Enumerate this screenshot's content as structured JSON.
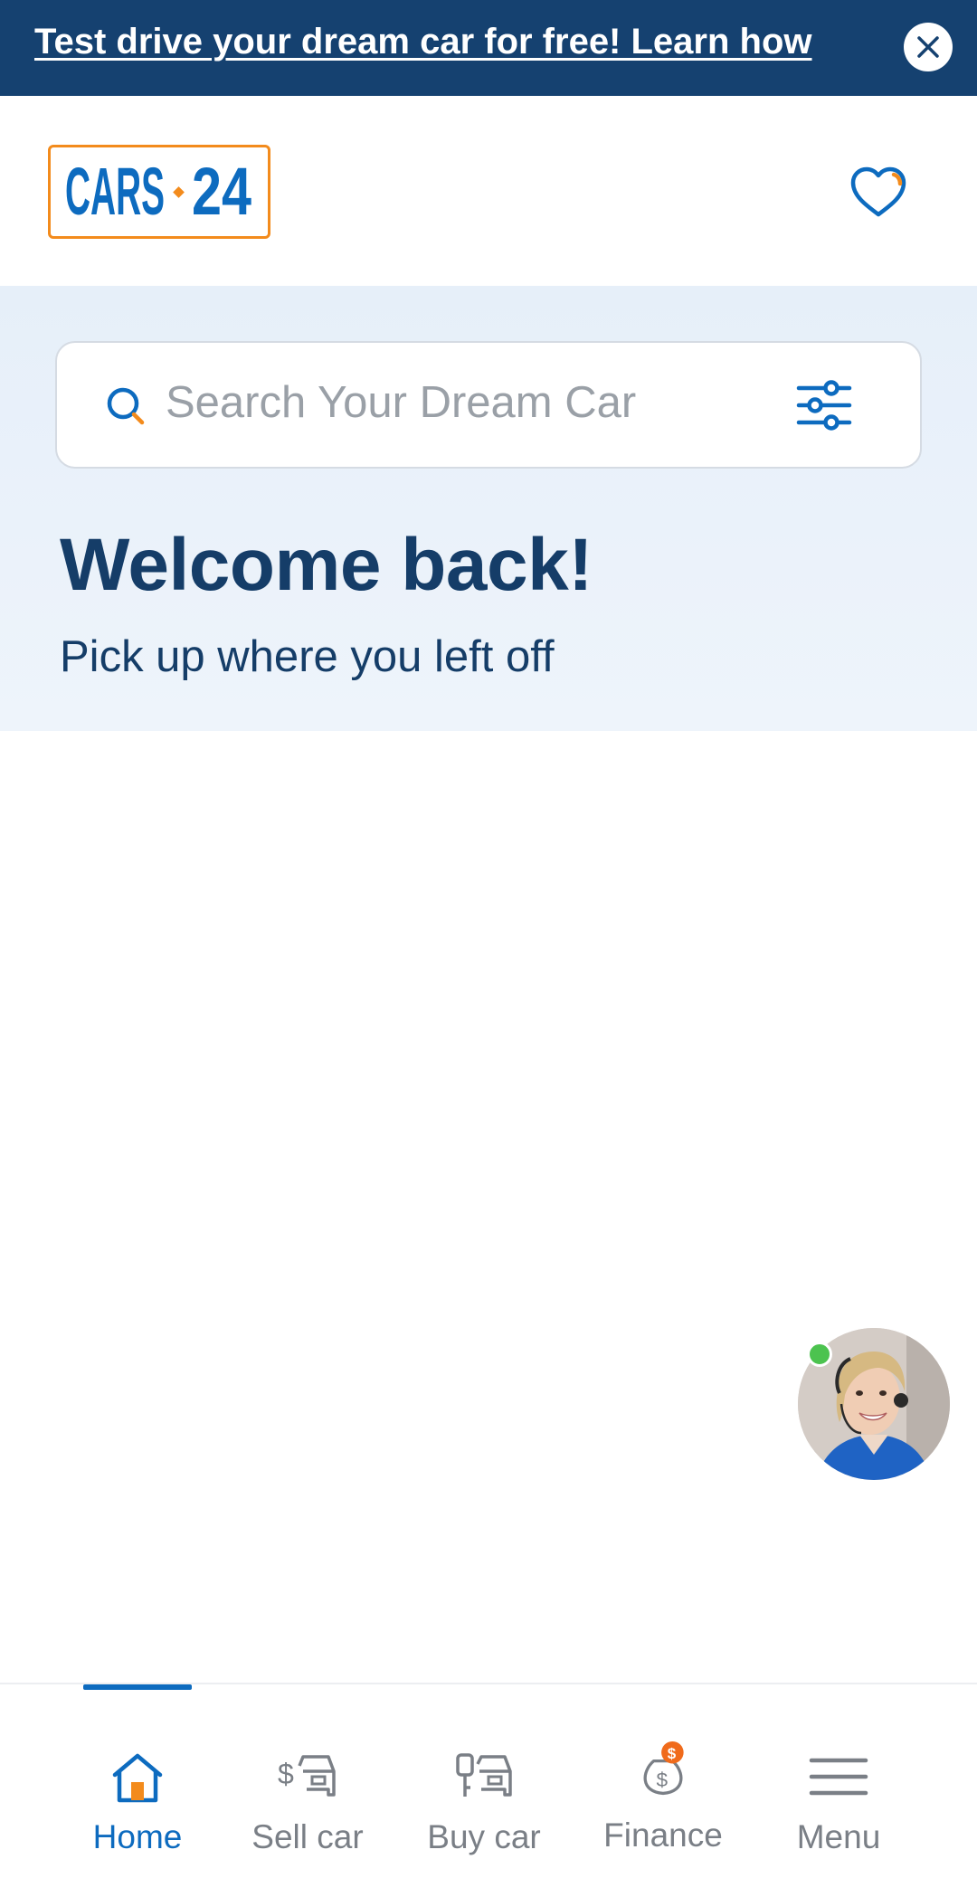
{
  "promo": {
    "text": "Test drive your dream car for free! Learn how",
    "close_icon": "close-icon"
  },
  "header": {
    "logo_text": "CARS·24",
    "favorites_icon": "heart-icon"
  },
  "search": {
    "placeholder": "Search Your Dream Car",
    "search_icon": "search-icon",
    "filter_icon": "filter-sliders-icon"
  },
  "welcome": {
    "title": "Welcome back!",
    "subtitle": "Pick up where you left off"
  },
  "chat_agent": {
    "status": "online",
    "status_color": "#4cc34f"
  },
  "bottom_nav": {
    "active_index": 0,
    "items": [
      {
        "label": "Home",
        "icon": "home-icon"
      },
      {
        "label": "Sell car",
        "icon": "sell-car-icon"
      },
      {
        "label": "Buy car",
        "icon": "buy-car-icon"
      },
      {
        "label": "Finance",
        "icon": "finance-icon"
      },
      {
        "label": "Menu",
        "icon": "menu-icon"
      }
    ]
  },
  "colors": {
    "brand_navy": "#154170",
    "brand_blue": "#0d6bbf",
    "brand_orange": "#f38b1c",
    "text_dark": "#153d68",
    "muted_gray": "#7a7f86"
  }
}
